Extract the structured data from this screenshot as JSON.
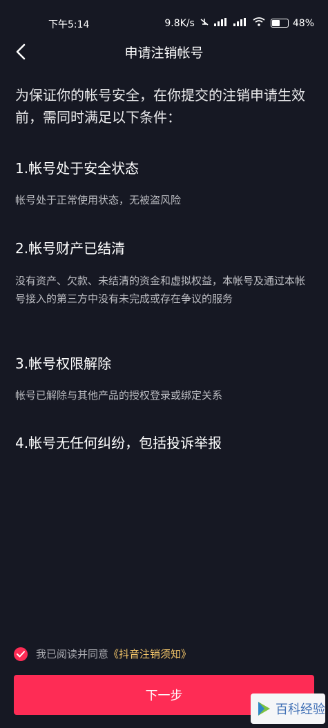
{
  "status_bar": {
    "time": "下午5:14",
    "network_speed": "9.8K/s",
    "battery": "48",
    "battery_suffix": "%"
  },
  "nav": {
    "title": "申请注销帐号",
    "back_icon": "chevron-left-icon"
  },
  "intro": "为保证你的帐号安全，在你提交的注销申请生效前，需同时满足以下条件：",
  "conditions": [
    {
      "title": "1.帐号处于安全状态",
      "desc": "帐号处于正常使用状态，无被盗风险"
    },
    {
      "title": "2.帐号财产已结清",
      "desc": "没有资产、欠款、未结清的资金和虚拟权益，本帐号及通过本帐号接入的第三方中没有未完成或存在争议的服务"
    },
    {
      "title": "3.帐号权限解除",
      "desc": "帐号已解除与其他产品的授权登录或绑定关系"
    },
    {
      "title": "4.帐号无任何纠纷，包括投诉举报",
      "desc": ""
    }
  ],
  "agreement": {
    "checked": true,
    "text": "我已阅读并同意",
    "link": "《抖音注销须知》"
  },
  "next_button": "下一步",
  "watermark": {
    "logo": "百科经验"
  },
  "colors": {
    "background": "#161823",
    "accent": "#fe2c55",
    "link": "#f7c86a"
  }
}
